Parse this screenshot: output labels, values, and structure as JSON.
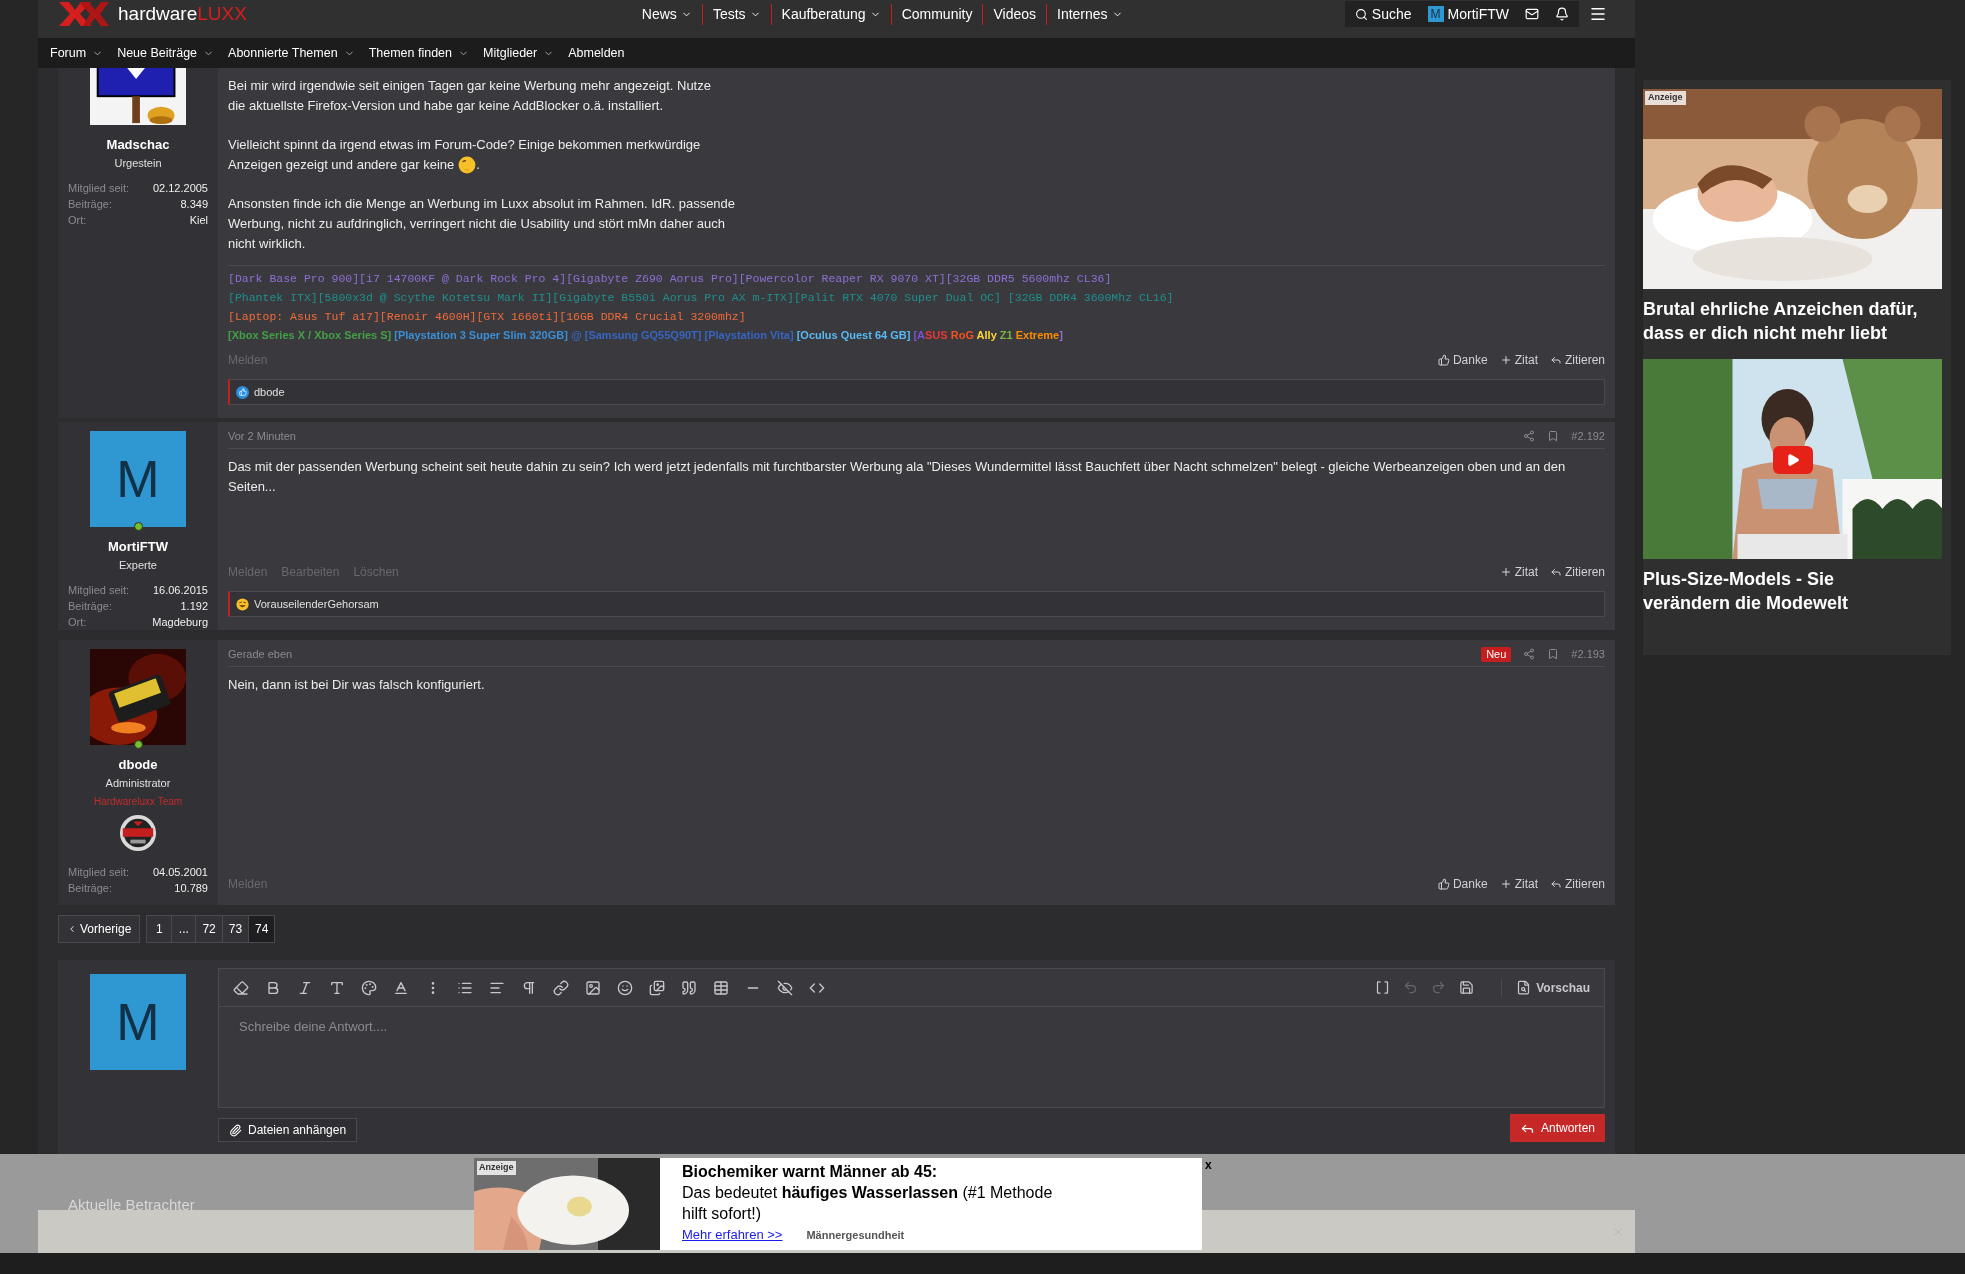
{
  "header": {
    "logo": {
      "text": "hardware",
      "accent": "LUXX"
    },
    "nav": [
      {
        "label": "News",
        "dropdown": true
      },
      {
        "label": "Tests",
        "dropdown": true
      },
      {
        "label": "Kaufberatung",
        "dropdown": true
      },
      {
        "label": "Community",
        "dropdown": false
      },
      {
        "label": "Videos",
        "dropdown": false
      },
      {
        "label": "Internes",
        "dropdown": true
      }
    ],
    "search": "Suche",
    "user_letter": "M",
    "username": "MortiFTW"
  },
  "subnav": [
    {
      "label": "Forum",
      "dropdown": true
    },
    {
      "label": "Neue Beiträge",
      "dropdown": true
    },
    {
      "label": "Abonnierte Themen",
      "dropdown": true
    },
    {
      "label": "Themen finden",
      "dropdown": true
    },
    {
      "label": "Mitglieder",
      "dropdown": true
    },
    {
      "label": "Abmelden",
      "dropdown": false
    }
  ],
  "posts": [
    {
      "author": {
        "name": "Madschac",
        "role": "Urgestein",
        "online": false,
        "stats": [
          {
            "label": "Mitglied seit:",
            "value": "02.12.2005"
          },
          {
            "label": "Beiträge:",
            "value": "8.349"
          },
          {
            "label": "Ort:",
            "value": "Kiel"
          }
        ]
      },
      "paragraphs": [
        {
          "text": "Bei mir wird irgendwie seit einigen Tagen gar keine Werbung mehr angezeigt. Nutze\ndie aktuellste Firefox-Version und habe gar keine AddBlocker o.ä. installiert."
        },
        {
          "lines": [
            [
              {
                "kind": "text",
                "text": "Vielleicht spinnt da irgend etwas im Forum-Code? Einige bekommen merkwürdige"
              }
            ],
            [
              {
                "kind": "text",
                "text": "Anzeigen gezeigt und andere gar keine"
              },
              {
                "kind": "emoji"
              },
              {
                "kind": "text",
                "text": "."
              }
            ]
          ]
        },
        {
          "text": "Ansonsten finde ich die Menge an Werbung im Luxx absolut im Rahmen. IdR. passende\nWerbung, nicht zu aufdringlich, verringert nicht die Usability und stört mMn daher auch\nnicht wirklich."
        }
      ],
      "signature": [
        {
          "kind": "mono",
          "segments": [
            {
              "text": "[Dark Base Pro 900][i7 14700KF @ Dark Rock Pro 4][Gigabyte Z690 Aorus Pro][Powercolor Reaper RX 9070 XT][32GB DDR5 5600mhz CL36]",
              "color": "#8f6fd6"
            }
          ]
        },
        {
          "kind": "mono",
          "segments": [
            {
              "text": "[Phantek ITX][5800x3d @ Scythe Kotetsu Mark II][Gigabyte B550i Aorus Pro AX m-ITX][Palit RTX 4070 Super Dual OC] [32GB DDR4 3600Mhz CL16]",
              "color": "#1f8f8f"
            }
          ]
        },
        {
          "kind": "mono",
          "segments": [
            {
              "text": "[Laptop: Asus Tuf a17][Renoir 4600H][GTX 1660ti][16GB DDR4 Crucial 3200mhz]",
              "color": "#f26b38"
            }
          ]
        },
        {
          "kind": "sans",
          "segments": [
            {
              "text": "[Xbox Series X / Xbox Series S]",
              "color": "#43a047"
            },
            {
              "text": " [Playstation 3 Super Slim 320GB]",
              "color": "#3b8fd6"
            },
            {
              "text": " @ [Samsung GQ55Q90T] [Playstation Vita]",
              "color": "#3666c2"
            },
            {
              "text": " [Oculus Quest 64 GB]",
              "color": "#59b9f2"
            },
            {
              "text": " [A",
              "color": "#7b52d6"
            },
            {
              "text": "SUS ",
              "color": "#e53935"
            },
            {
              "text": "RoG ",
              "color": "#f4511e"
            },
            {
              "text": "Ally ",
              "color": "#fdd835"
            },
            {
              "text": "Z1 ",
              "color": "#7cb342"
            },
            {
              "text": "Extreme",
              "color": "#fb8c00"
            },
            {
              "text": "]",
              "color": "#8e6fd6"
            }
          ]
        }
      ],
      "actions_left": [
        "Melden"
      ],
      "actions_right": [
        {
          "kind": "thanks",
          "label": "Danke"
        },
        {
          "kind": "quote",
          "label": "Zitat"
        },
        {
          "kind": "reply",
          "label": "Zitieren"
        }
      ],
      "reaction": {
        "kind": "like",
        "users": "dbode"
      }
    },
    {
      "time": "Vor 2 Minuten",
      "number": "#2.192",
      "new": false,
      "author": {
        "name": "MortiFTW",
        "role": "Experte",
        "avatar": {
          "kind": "letter",
          "letter": "M"
        },
        "online": true,
        "stats": [
          {
            "label": "Mitglied seit:",
            "value": "16.06.2015"
          },
          {
            "label": "Beiträge:",
            "value": "1.192"
          },
          {
            "label": "Ort:",
            "value": "Magdeburg"
          }
        ]
      },
      "paragraphs": [
        {
          "text": "Das mit der passenden Werbung scheint seit heute dahin zu sein? Ich werd jetzt jedenfalls mit furchtbarster Werbung ala \"Dieses Wundermittel lässt Bauchfett über Nacht schmelzen\" belegt - gleiche Werbeanzeigen oben und an den Seiten..."
        }
      ],
      "actions_left": [
        "Melden",
        "Bearbeiten",
        "Löschen"
      ],
      "actions_right": [
        {
          "kind": "quote",
          "label": "Zitat"
        },
        {
          "kind": "reply",
          "label": "Zitieren"
        }
      ],
      "reaction": {
        "kind": "laugh",
        "users": "VorauseilenderGehorsam"
      }
    },
    {
      "time": "Gerade eben",
      "number": "#2.193",
      "new": true,
      "new_label": "Neu",
      "author": {
        "name": "dbode",
        "role": "Administrator",
        "team": "Hardwareluxx Team",
        "supporter": true,
        "online": true,
        "stats": [
          {
            "label": "Mitglied seit:",
            "value": "04.05.2001"
          },
          {
            "label": "Beiträge:",
            "value": "10.789"
          }
        ]
      },
      "paragraphs": [
        {
          "text": "Nein, dann ist bei Dir was falsch konfiguriert."
        }
      ],
      "actions_left": [
        "Melden"
      ],
      "actions_right": [
        {
          "kind": "thanks",
          "label": "Danke"
        },
        {
          "kind": "quote",
          "label": "Zitat"
        },
        {
          "kind": "reply",
          "label": "Zitieren"
        }
      ]
    }
  ],
  "pagination": {
    "prev": "Vorherige",
    "pages": [
      {
        "label": "1",
        "selected": false
      },
      {
        "label": "...",
        "selected": false
      },
      {
        "label": "72",
        "selected": false
      },
      {
        "label": "73",
        "selected": false
      },
      {
        "label": "74",
        "selected": true
      }
    ]
  },
  "editor": {
    "avatar_letter": "M",
    "placeholder": "Schreibe deine Antwort....",
    "preview": "Vorschau",
    "attach": "Dateien anhängen",
    "submit": "Antworten"
  },
  "viewers_title": "Aktuelle Betrachter",
  "sidebar_ads": [
    {
      "label": "Anzeige",
      "video": false,
      "caption": "Brutal ehrliche Anzeichen dafür, dass er dich nicht mehr liebt"
    },
    {
      "video": true,
      "caption": "Plus-Size-Models - Sie verändern die Modewelt"
    }
  ],
  "bottom_ad": {
    "label": "Anzeige",
    "headline": "Biochemiker warnt Männer ab 45:",
    "text": "Das bedeutet **häufiges Wasserlassen** (#1 Methode hilft sofort!)",
    "link": "Mehr erfahren >>",
    "source": "Männergesundheit",
    "close": "x"
  }
}
